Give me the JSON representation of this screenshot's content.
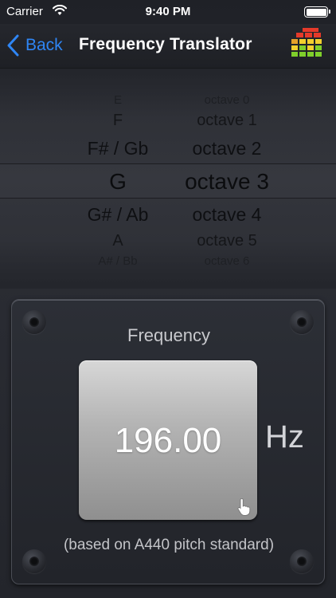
{
  "status_bar": {
    "carrier": "Carrier",
    "time": "9:40 PM"
  },
  "nav": {
    "back_label": "Back",
    "title": "Frequency Translator"
  },
  "picker": {
    "rows": [
      {
        "note": "E",
        "octave": "octave 0"
      },
      {
        "note": "F",
        "octave": "octave 1"
      },
      {
        "note": "F# / Gb",
        "octave": "octave 2"
      },
      {
        "note": "G",
        "octave": "octave 3"
      },
      {
        "note": "G# / Ab",
        "octave": "octave 4"
      },
      {
        "note": "A",
        "octave": "octave 5"
      },
      {
        "note": "A# / Bb",
        "octave": "octave 6"
      }
    ],
    "selected_index": 3
  },
  "panel": {
    "label": "Frequency",
    "value": "196.00",
    "unit": "Hz",
    "footnote": "(based on A440 pitch standard)"
  },
  "colors": {
    "accent": "#2f86f5",
    "display_gray": "#b4b4b4"
  },
  "icons": [
    "back-chevron-icon",
    "wifi-icon",
    "battery-icon",
    "app-logo-icon",
    "tap-hand-icon",
    "screw-icon"
  ]
}
